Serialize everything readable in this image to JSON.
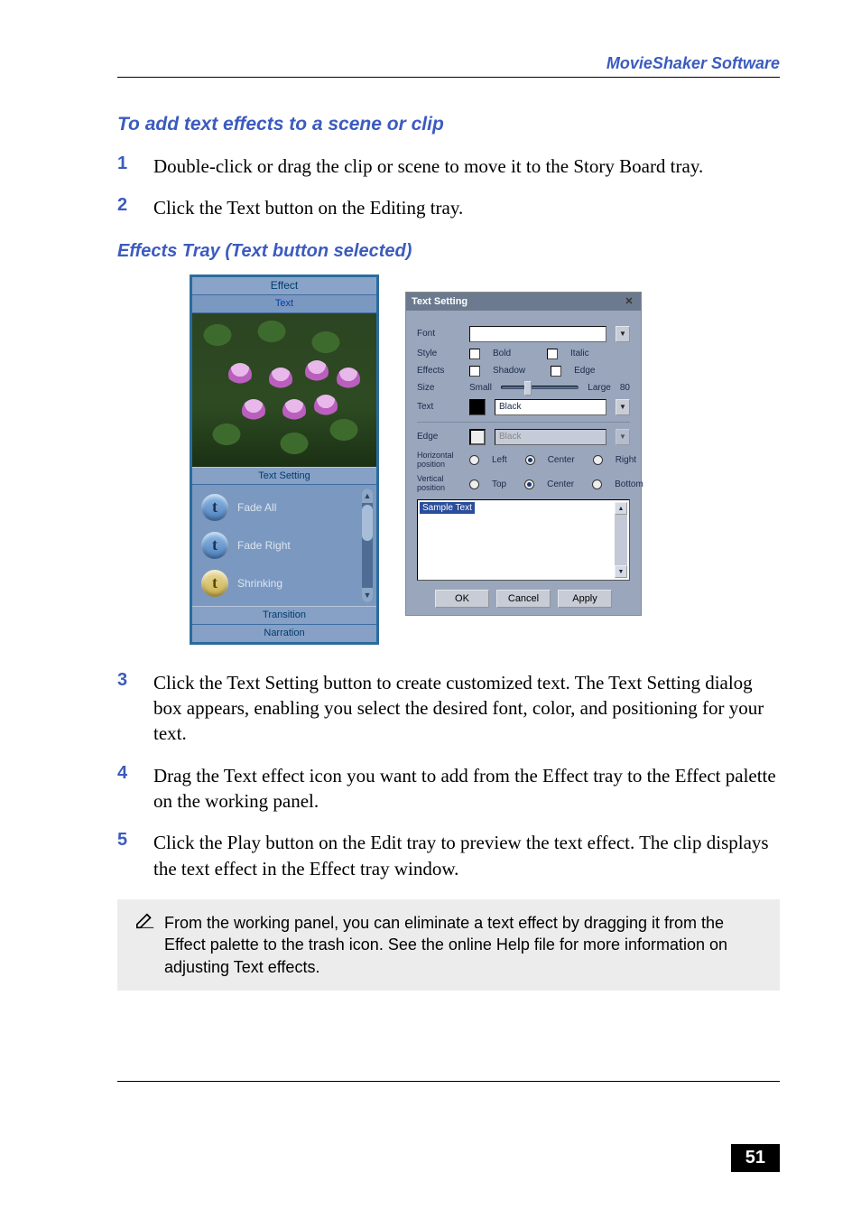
{
  "header": {
    "title": "MovieShaker Software"
  },
  "section1": {
    "heading": "To add text effects to a scene or clip",
    "steps": [
      "Double-click or drag the clip or scene to move it to the Story Board tray.",
      "Click the Text button on the Editing tray."
    ]
  },
  "figure_caption": "Effects Tray (Text button selected)",
  "effects_panel": {
    "title": "Effect",
    "tab": "Text",
    "text_setting_button": "Text Setting",
    "effects": [
      "Fade All",
      "Fade Right",
      "Shrinking"
    ],
    "bottom_tabs": [
      "Transition",
      "Narration"
    ]
  },
  "text_setting_dialog": {
    "title": "Text Setting",
    "font_label": "Font",
    "style_label": "Style",
    "bold": "Bold",
    "italic": "Italic",
    "effects_label": "Effects",
    "shadow": "Shadow",
    "edge": "Edge",
    "size_label": "Size",
    "small": "Small",
    "large": "Large",
    "size_value": "80",
    "text_label": "Text",
    "text_color_name": "Black",
    "edge_label": "Edge",
    "edge_color_name": "Black",
    "hpos_label": "Horizontal\nposition",
    "hpos_left": "Left",
    "hpos_center": "Center",
    "hpos_right": "Right",
    "vpos_label": "Vertical\nposition",
    "vpos_top": "Top",
    "vpos_center": "Center",
    "vpos_bottom": "Bottom",
    "sample_text": "Sample Text",
    "ok": "OK",
    "cancel": "Cancel",
    "apply": "Apply"
  },
  "section2": {
    "steps": [
      "Click the Text Setting button to create customized text. The Text Setting dialog box appears, enabling you select the desired font, color, and positioning for your text.",
      "Drag the Text effect icon you want to add from the Effect tray to the Effect palette on the working panel.",
      "Click the Play button on the Edit tray to preview the text effect. The clip displays the text effect in the Effect tray window."
    ]
  },
  "note": "From the working panel, you can eliminate a text effect by dragging it from the Effect palette to the trash icon. See the online Help file for more information on adjusting Text effects.",
  "page_number": "51"
}
